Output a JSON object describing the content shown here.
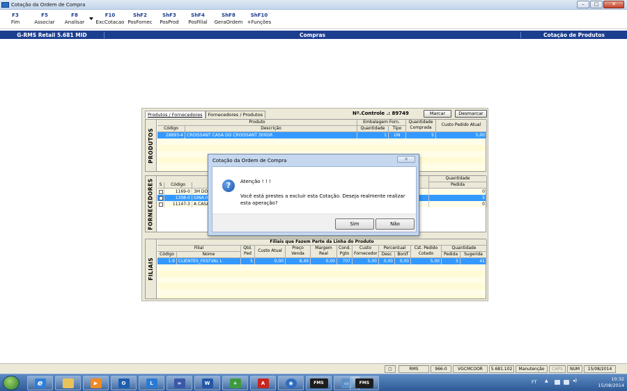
{
  "window": {
    "title": "Cotação da Ordem de Compra"
  },
  "fkeys": [
    {
      "key": "F3",
      "label": "Fim"
    },
    {
      "key": "F5",
      "label": "Associar"
    },
    {
      "key": "F8",
      "label": "Analisar"
    },
    {
      "key": "F10",
      "label": "ExcCotacao"
    },
    {
      "key": "ShF2",
      "label": "PosFornec"
    },
    {
      "key": "ShF3",
      "label": "PosProd"
    },
    {
      "key": "ShF4",
      "label": "PosFilial"
    },
    {
      "key": "ShF8",
      "label": "GeraOrdem"
    },
    {
      "key": "ShF10",
      "label": "+Funções"
    }
  ],
  "header": {
    "left": "G-RMS Retail 5.681 MID",
    "center": "Compras",
    "right": "Cotação de Produtos"
  },
  "panel": {
    "tabs": [
      "Produtos / Fornecedores",
      "Fornecedores / Produtos"
    ],
    "controle": "Nº.Controle .: 89749",
    "marcar": "Marcar",
    "desmarcar": "Desmarcar"
  },
  "produtos": {
    "side": "PRODUTOS",
    "h_produto": "Produto",
    "h_emb": "Embalagem Forn.",
    "h_qtdcomp_1": "Quantidade",
    "h_qtdcomp_2": "Comprada",
    "h_custo": "Custo Pedido Atual",
    "h_codigo": "Código",
    "h_descricao": "Descrição",
    "h_quantidade": "Quantidade",
    "h_tipo": "Tipo",
    "row": {
      "codigo": "28893-4",
      "descricao": "CROISSANT CASA DO CROISSANT 300GR",
      "quantidade": "1",
      "tipo": "UN",
      "comprada": "5",
      "custo": "5,00"
    }
  },
  "fornecedores": {
    "side": "FORNECEDORES",
    "h_s": "S",
    "h_codigo": "Código",
    "h_quantidade": "Quantidade",
    "h_pedida": "Pedida",
    "rows": [
      {
        "codigo": "1169-0",
        "nome": "3M DO B",
        "pedida": "0"
      },
      {
        "codigo": "1308-0",
        "nome": "GINA IN",
        "pedida": "5"
      },
      {
        "codigo": "11147-3",
        "nome": "A CASA",
        "pedida": "0"
      }
    ]
  },
  "filiais": {
    "side": "FILIAIS",
    "title": "Filiais que Fazem Parte da Linha do Produto",
    "h_filial": "Filial",
    "h_codigo": "Código",
    "h_nome": "Nome",
    "h_qtd_1": "Qtd.",
    "h_qtd_2": "Ped",
    "h_custo_atual": "Custo Atual",
    "h_preco_1": "Preço",
    "h_preco_2": "Venda",
    "h_margem_1": "Margem",
    "h_margem_2": "Real",
    "h_cond_1": "Cond.",
    "h_cond_2": "Pgto",
    "h_custo_forn_1": "Custo",
    "h_custo_forn_2": "Fornecedor",
    "h_percentual": "Percentual",
    "h_desc": "Desc",
    "h_bonif": "Bonif",
    "h_cst_1": "Cst. Pedido",
    "h_cst_2": "Cotado",
    "h_quantidade": "Quantidade",
    "h_pedida": "Pedida",
    "h_sugerida": "Sugerida",
    "row": {
      "codigo": "1-9",
      "nome": "CLIENTES_FESTVAL L",
      "qtd": "5",
      "custo_atual": "0,00",
      "preco": "8,49",
      "margem": "0,00",
      "cond": "707",
      "custo_forn": "5,00",
      "desc": "0,00",
      "bonif": "0,00",
      "cst": "5,00",
      "pedida": "5",
      "sugerida": "41"
    }
  },
  "dialog": {
    "title": "Cotação da Ordem de Compra",
    "heading": "Atenção ! ! !",
    "message": "Você está prestes a excluir esta Cotação. Deseja realmente realizar esta operação?",
    "yes": "Sim",
    "no": "Não"
  },
  "status": {
    "rms": "RMS",
    "num": "966-0",
    "user": "VGCMCOOR",
    "ver": "5.681.102",
    "mode": "Manutenção",
    "caps": "CAPS",
    "numlock": "NUM",
    "date": "15/08/2014"
  },
  "taskbar": {
    "lang": "FT",
    "time": "10:32",
    "date": "15/08/2014",
    "fms1": "FMS",
    "fms2": "FMS"
  },
  "colors": {
    "accent": "#1c3e8f",
    "selection": "#3399ff"
  }
}
